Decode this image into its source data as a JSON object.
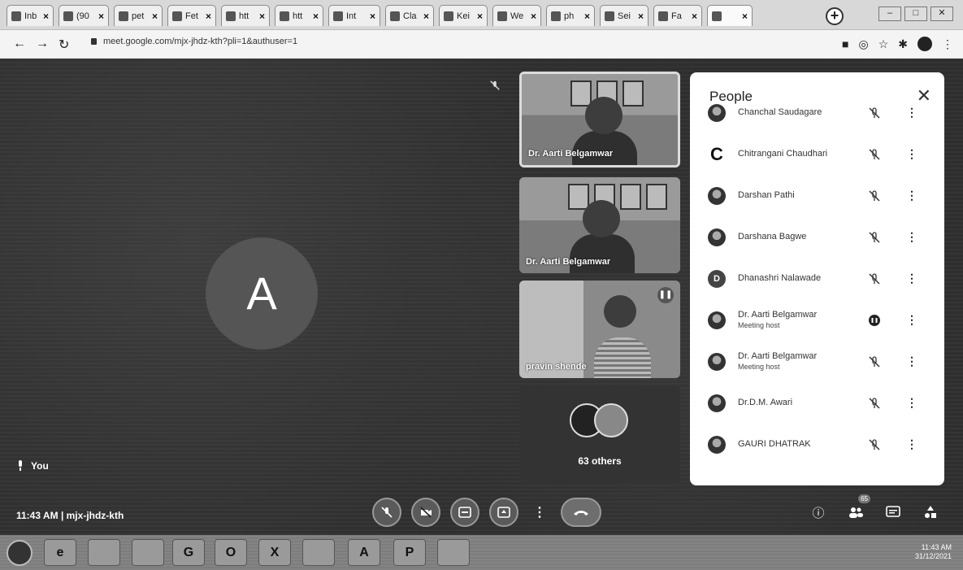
{
  "browser": {
    "tabs": [
      {
        "label": "Inb",
        "icon": "gmail-icon"
      },
      {
        "label": "(90",
        "icon": "circle-icon"
      },
      {
        "label": "pet",
        "icon": "doc-icon"
      },
      {
        "label": "Fet",
        "icon": "doc-icon"
      },
      {
        "label": "htt",
        "icon": "doc-icon"
      },
      {
        "label": "htt",
        "icon": "doc-icon"
      },
      {
        "label": "Int",
        "icon": "gmail-icon"
      },
      {
        "label": "Cla",
        "icon": "classroom-icon"
      },
      {
        "label": "Kei",
        "icon": "doc-icon"
      },
      {
        "label": "We",
        "icon": "whatsapp-icon"
      },
      {
        "label": "ph",
        "icon": "circle-icon"
      },
      {
        "label": "Sei",
        "icon": "google-icon"
      },
      {
        "label": "Fa",
        "icon": "facebook-icon"
      },
      {
        "label": "",
        "icon": "meet-icon"
      }
    ],
    "new_tab": "+",
    "url": "meet.google.com/mjx-jhdz-kth?pli=1&authuser=1"
  },
  "meet": {
    "self_initial": "A",
    "self_label": "You",
    "tiles": [
      {
        "name": "Dr. Aarti Belgamwar"
      },
      {
        "name": "Dr. Aarti Belgamwar"
      },
      {
        "name": "pravin shende"
      }
    ],
    "others_label": "63 others",
    "time": "11:43 AM",
    "separator": "|",
    "meeting_code": "mjx-jhdz-kth"
  },
  "people_panel": {
    "title": "People",
    "participants": [
      {
        "name": "Chanchal Saudagare",
        "avatar": "photo",
        "initial": "",
        "sub": "",
        "mic": "muted"
      },
      {
        "name": "Chitrangani Chaudhari",
        "avatar": "letter",
        "initial": "C",
        "sub": "",
        "mic": "muted"
      },
      {
        "name": "Darshan Pathi",
        "avatar": "photo",
        "initial": "",
        "sub": "",
        "mic": "muted"
      },
      {
        "name": "Darshana Bagwe",
        "avatar": "photo",
        "initial": "",
        "sub": "",
        "mic": "muted"
      },
      {
        "name": "Dhanashri Nalawade",
        "avatar": "initial",
        "initial": "D",
        "sub": "",
        "mic": "muted"
      },
      {
        "name": "Dr. Aarti Belgamwar",
        "avatar": "photo",
        "initial": "",
        "sub": "Meeting host",
        "mic": "speaking"
      },
      {
        "name": "Dr. Aarti Belgamwar",
        "avatar": "photo",
        "initial": "",
        "sub": "Meeting host",
        "mic": "muted"
      },
      {
        "name": "Dr.D.M. Awari",
        "avatar": "photo",
        "initial": "",
        "sub": "",
        "mic": "muted"
      },
      {
        "name": "GAURI DHATRAK",
        "avatar": "photo",
        "initial": "",
        "sub": "",
        "mic": "muted"
      }
    ]
  },
  "controls": {
    "participant_count": "65"
  },
  "taskbar": {
    "apps": [
      "ie-icon",
      "explorer-icon",
      "media-icon",
      "chrome-icon",
      "opera-icon",
      "excel-icon",
      "paint-icon",
      "acrobat-icon",
      "powerpoint-icon",
      "meet-icon"
    ],
    "app_letters": [
      "e",
      "",
      "",
      "G",
      "O",
      "X",
      "",
      "A",
      "P",
      ""
    ],
    "clock_time": "11:43 AM",
    "clock_date": "31/12/2021"
  }
}
